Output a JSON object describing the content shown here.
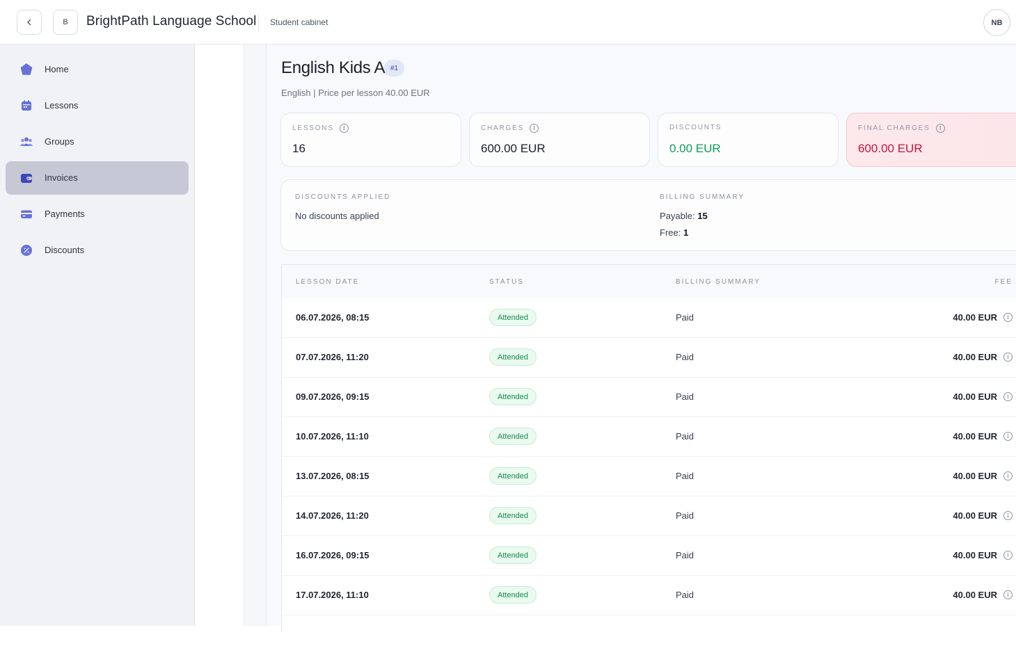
{
  "header": {
    "logo_letter": "B",
    "app_title": "BrightPath Language School",
    "subtitle": "Student cabinet",
    "avatar_initials": "NB"
  },
  "sidebar": {
    "items": [
      {
        "label": "Home",
        "icon": "home-icon"
      },
      {
        "label": "Lessons",
        "icon": "calendar-icon"
      },
      {
        "label": "Groups",
        "icon": "users-icon"
      },
      {
        "label": "Invoices",
        "icon": "wallet-icon",
        "active": true
      },
      {
        "label": "Payments",
        "icon": "credit-card-icon"
      },
      {
        "label": "Discounts",
        "icon": "percent-icon"
      }
    ]
  },
  "group": {
    "title": "English Kids A",
    "badge": "#1",
    "meta": "English | Price per lesson 40.00 EUR"
  },
  "stats": {
    "lessons_label": "Lessons",
    "lessons_value": "16",
    "charges_label": "Charges",
    "charges_value": "600.00 EUR",
    "discounts_label": "Discounts",
    "discounts_value": "0.00 EUR",
    "final_label": "Final charges",
    "final_value": "600.00 EUR"
  },
  "summary": {
    "discounts_applied_label": "Discounts applied",
    "discounts_applied_text": "No discounts applied",
    "billing_summary_label": "Billing summary",
    "payable_label": "Payable:",
    "payable_value": "15",
    "free_label": "Free:",
    "free_value": "1"
  },
  "table": {
    "columns": [
      "Lesson date",
      "Status",
      "Billing summary",
      "Fee"
    ],
    "rows": [
      {
        "date": "06.07.2026, 08:15",
        "status": "Attended",
        "billing": "Paid",
        "fee": "40.00 EUR"
      },
      {
        "date": "07.07.2026, 11:20",
        "status": "Attended",
        "billing": "Paid",
        "fee": "40.00 EUR"
      },
      {
        "date": "09.07.2026, 09:15",
        "status": "Attended",
        "billing": "Paid",
        "fee": "40.00 EUR"
      },
      {
        "date": "10.07.2026, 11:10",
        "status": "Attended",
        "billing": "Paid",
        "fee": "40.00 EUR"
      },
      {
        "date": "13.07.2026, 08:15",
        "status": "Attended",
        "billing": "Paid",
        "fee": "40.00 EUR"
      },
      {
        "date": "14.07.2026, 11:20",
        "status": "Attended",
        "billing": "Paid",
        "fee": "40.00 EUR"
      },
      {
        "date": "16.07.2026, 09:15",
        "status": "Attended",
        "billing": "Paid",
        "fee": "40.00 EUR"
      },
      {
        "date": "17.07.2026, 11:10",
        "status": "Attended",
        "billing": "Paid",
        "fee": "40.00 EUR"
      }
    ]
  },
  "colors": {
    "accent": "#5a67d8",
    "active_nav_bg": "#c7c8d6",
    "success": "#0f9d58",
    "danger": "#c8143c"
  }
}
